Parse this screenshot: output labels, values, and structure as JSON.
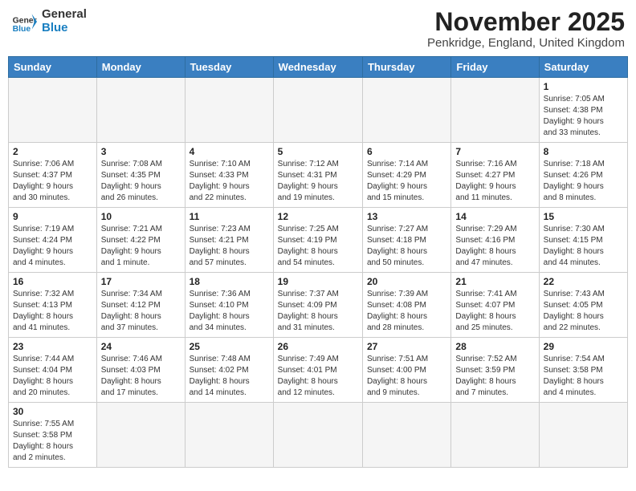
{
  "header": {
    "logo_general": "General",
    "logo_blue": "Blue",
    "month_title": "November 2025",
    "location": "Penkridge, England, United Kingdom"
  },
  "weekdays": [
    "Sunday",
    "Monday",
    "Tuesday",
    "Wednesday",
    "Thursday",
    "Friday",
    "Saturday"
  ],
  "weeks": [
    [
      {
        "day": "",
        "info": ""
      },
      {
        "day": "",
        "info": ""
      },
      {
        "day": "",
        "info": ""
      },
      {
        "day": "",
        "info": ""
      },
      {
        "day": "",
        "info": ""
      },
      {
        "day": "",
        "info": ""
      },
      {
        "day": "1",
        "info": "Sunrise: 7:05 AM\nSunset: 4:38 PM\nDaylight: 9 hours\nand 33 minutes."
      }
    ],
    [
      {
        "day": "2",
        "info": "Sunrise: 7:06 AM\nSunset: 4:37 PM\nDaylight: 9 hours\nand 30 minutes."
      },
      {
        "day": "3",
        "info": "Sunrise: 7:08 AM\nSunset: 4:35 PM\nDaylight: 9 hours\nand 26 minutes."
      },
      {
        "day": "4",
        "info": "Sunrise: 7:10 AM\nSunset: 4:33 PM\nDaylight: 9 hours\nand 22 minutes."
      },
      {
        "day": "5",
        "info": "Sunrise: 7:12 AM\nSunset: 4:31 PM\nDaylight: 9 hours\nand 19 minutes."
      },
      {
        "day": "6",
        "info": "Sunrise: 7:14 AM\nSunset: 4:29 PM\nDaylight: 9 hours\nand 15 minutes."
      },
      {
        "day": "7",
        "info": "Sunrise: 7:16 AM\nSunset: 4:27 PM\nDaylight: 9 hours\nand 11 minutes."
      },
      {
        "day": "8",
        "info": "Sunrise: 7:18 AM\nSunset: 4:26 PM\nDaylight: 9 hours\nand 8 minutes."
      }
    ],
    [
      {
        "day": "9",
        "info": "Sunrise: 7:19 AM\nSunset: 4:24 PM\nDaylight: 9 hours\nand 4 minutes."
      },
      {
        "day": "10",
        "info": "Sunrise: 7:21 AM\nSunset: 4:22 PM\nDaylight: 9 hours\nand 1 minute."
      },
      {
        "day": "11",
        "info": "Sunrise: 7:23 AM\nSunset: 4:21 PM\nDaylight: 8 hours\nand 57 minutes."
      },
      {
        "day": "12",
        "info": "Sunrise: 7:25 AM\nSunset: 4:19 PM\nDaylight: 8 hours\nand 54 minutes."
      },
      {
        "day": "13",
        "info": "Sunrise: 7:27 AM\nSunset: 4:18 PM\nDaylight: 8 hours\nand 50 minutes."
      },
      {
        "day": "14",
        "info": "Sunrise: 7:29 AM\nSunset: 4:16 PM\nDaylight: 8 hours\nand 47 minutes."
      },
      {
        "day": "15",
        "info": "Sunrise: 7:30 AM\nSunset: 4:15 PM\nDaylight: 8 hours\nand 44 minutes."
      }
    ],
    [
      {
        "day": "16",
        "info": "Sunrise: 7:32 AM\nSunset: 4:13 PM\nDaylight: 8 hours\nand 41 minutes."
      },
      {
        "day": "17",
        "info": "Sunrise: 7:34 AM\nSunset: 4:12 PM\nDaylight: 8 hours\nand 37 minutes."
      },
      {
        "day": "18",
        "info": "Sunrise: 7:36 AM\nSunset: 4:10 PM\nDaylight: 8 hours\nand 34 minutes."
      },
      {
        "day": "19",
        "info": "Sunrise: 7:37 AM\nSunset: 4:09 PM\nDaylight: 8 hours\nand 31 minutes."
      },
      {
        "day": "20",
        "info": "Sunrise: 7:39 AM\nSunset: 4:08 PM\nDaylight: 8 hours\nand 28 minutes."
      },
      {
        "day": "21",
        "info": "Sunrise: 7:41 AM\nSunset: 4:07 PM\nDaylight: 8 hours\nand 25 minutes."
      },
      {
        "day": "22",
        "info": "Sunrise: 7:43 AM\nSunset: 4:05 PM\nDaylight: 8 hours\nand 22 minutes."
      }
    ],
    [
      {
        "day": "23",
        "info": "Sunrise: 7:44 AM\nSunset: 4:04 PM\nDaylight: 8 hours\nand 20 minutes."
      },
      {
        "day": "24",
        "info": "Sunrise: 7:46 AM\nSunset: 4:03 PM\nDaylight: 8 hours\nand 17 minutes."
      },
      {
        "day": "25",
        "info": "Sunrise: 7:48 AM\nSunset: 4:02 PM\nDaylight: 8 hours\nand 14 minutes."
      },
      {
        "day": "26",
        "info": "Sunrise: 7:49 AM\nSunset: 4:01 PM\nDaylight: 8 hours\nand 12 minutes."
      },
      {
        "day": "27",
        "info": "Sunrise: 7:51 AM\nSunset: 4:00 PM\nDaylight: 8 hours\nand 9 minutes."
      },
      {
        "day": "28",
        "info": "Sunrise: 7:52 AM\nSunset: 3:59 PM\nDaylight: 8 hours\nand 7 minutes."
      },
      {
        "day": "29",
        "info": "Sunrise: 7:54 AM\nSunset: 3:58 PM\nDaylight: 8 hours\nand 4 minutes."
      }
    ],
    [
      {
        "day": "30",
        "info": "Sunrise: 7:55 AM\nSunset: 3:58 PM\nDaylight: 8 hours\nand 2 minutes."
      },
      {
        "day": "",
        "info": ""
      },
      {
        "day": "",
        "info": ""
      },
      {
        "day": "",
        "info": ""
      },
      {
        "day": "",
        "info": ""
      },
      {
        "day": "",
        "info": ""
      },
      {
        "day": "",
        "info": ""
      }
    ]
  ]
}
